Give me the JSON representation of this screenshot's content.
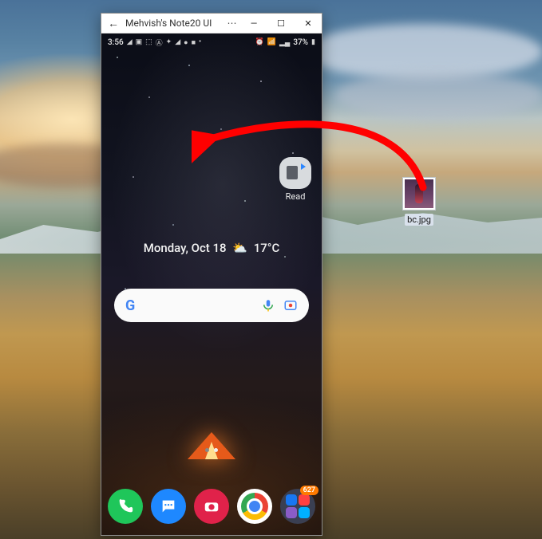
{
  "window": {
    "title": "Mehvish's Note20 UI",
    "back": "←",
    "more": "⋯",
    "min": "—",
    "max": "☐",
    "close": "✕"
  },
  "statusbar": {
    "time": "3:56",
    "left_icons": [
      "◢",
      "▣",
      "⬚",
      "Ⓐ",
      "✦",
      "◢",
      "●",
      "■",
      "•"
    ],
    "right_icons": [
      "⏰",
      "📶",
      "▂▄",
      "37%",
      "▮"
    ],
    "battery_text": "37%"
  },
  "home": {
    "app": {
      "label": "Read"
    },
    "date_text": "Monday, Oct 18",
    "weather_icon": "⛅",
    "temp": "17°C"
  },
  "search": {
    "placeholder": ""
  },
  "dock": {
    "folder_badge": "627"
  },
  "desktop_file": {
    "name": "bc.jpg"
  }
}
